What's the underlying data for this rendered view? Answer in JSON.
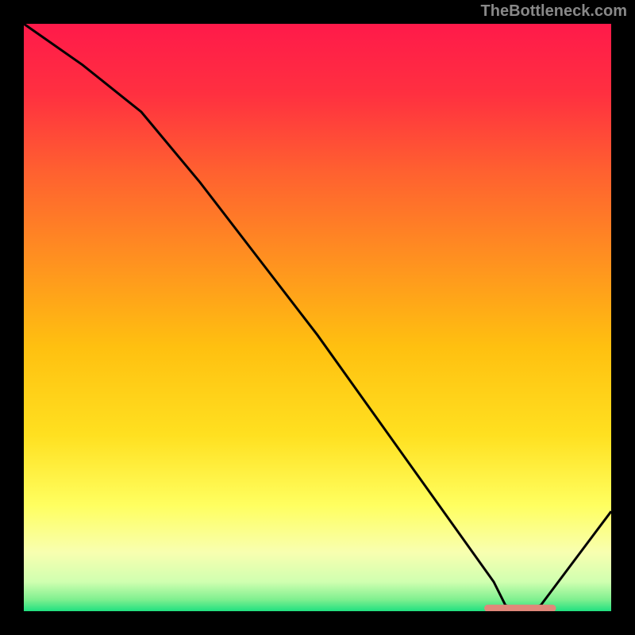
{
  "watermark": "TheBottleneck.com",
  "chart_data": {
    "type": "line",
    "title": "",
    "xlabel": "",
    "ylabel": "",
    "x": [
      0,
      10,
      20,
      30,
      40,
      50,
      60,
      70,
      80,
      82,
      85,
      88,
      100
    ],
    "values": [
      100,
      93,
      85,
      73,
      60,
      47,
      33,
      19,
      5,
      1,
      0,
      1,
      17
    ],
    "ylim": [
      0,
      100
    ],
    "xlim": [
      0,
      100
    ],
    "marker": {
      "x_start": 79,
      "x_end": 90,
      "y": 0.5
    },
    "gradient_stops": [
      {
        "offset": 0,
        "color": "#ff1a4a"
      },
      {
        "offset": 12,
        "color": "#ff3040"
      },
      {
        "offset": 25,
        "color": "#ff6030"
      },
      {
        "offset": 40,
        "color": "#ff9020"
      },
      {
        "offset": 55,
        "color": "#ffc010"
      },
      {
        "offset": 70,
        "color": "#ffe020"
      },
      {
        "offset": 82,
        "color": "#ffff60"
      },
      {
        "offset": 90,
        "color": "#f8ffb0"
      },
      {
        "offset": 95,
        "color": "#d0ffb0"
      },
      {
        "offset": 98,
        "color": "#80f090"
      },
      {
        "offset": 100,
        "color": "#20e080"
      }
    ]
  }
}
